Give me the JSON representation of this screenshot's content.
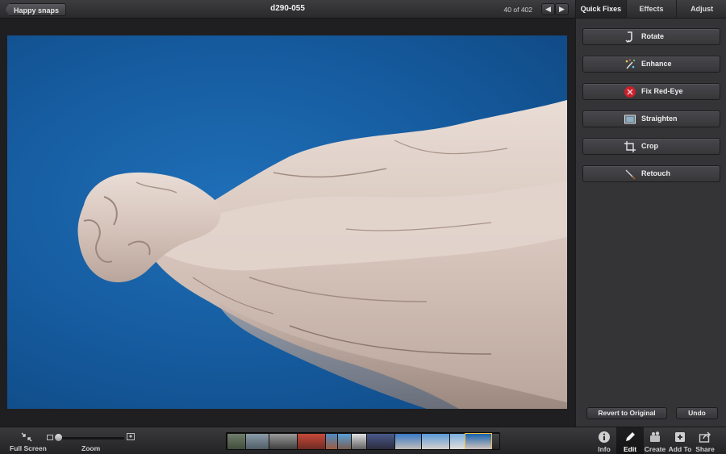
{
  "topbar": {
    "back_label": "Happy snaps",
    "title": "d290-055",
    "counter": "40 of 402",
    "prev_icon": "arrow-left-icon",
    "next_icon": "arrow-right-icon"
  },
  "panel": {
    "tabs": [
      {
        "label": "Quick Fixes",
        "active": true
      },
      {
        "label": "Effects",
        "active": false
      },
      {
        "label": "Adjust",
        "active": false
      }
    ],
    "fixes": [
      {
        "label": "Rotate",
        "icon": "rotate-icon"
      },
      {
        "label": "Enhance",
        "icon": "magic-wand-icon"
      },
      {
        "label": "Fix Red-Eye",
        "icon": "red-eye-icon"
      },
      {
        "label": "Straighten",
        "icon": "straighten-icon"
      },
      {
        "label": "Crop",
        "icon": "crop-icon"
      },
      {
        "label": "Retouch",
        "icon": "brush-icon"
      }
    ],
    "revert_label": "Revert to Original",
    "undo_label": "Undo"
  },
  "bottombar": {
    "fullscreen_label": "Full Screen",
    "zoom_label": "Zoom",
    "tools": [
      {
        "label": "Info",
        "icon": "info-icon",
        "active": false
      },
      {
        "label": "Edit",
        "icon": "pencil-icon",
        "active": true
      },
      {
        "label": "Create",
        "icon": "create-icon",
        "active": false
      },
      {
        "label": "Add To",
        "icon": "add-icon",
        "active": false
      },
      {
        "label": "Share",
        "icon": "share-icon",
        "active": false
      }
    ]
  },
  "colors": {
    "sky": "#1862ab",
    "panel": "#343437",
    "statue": "#d9c8c0"
  }
}
